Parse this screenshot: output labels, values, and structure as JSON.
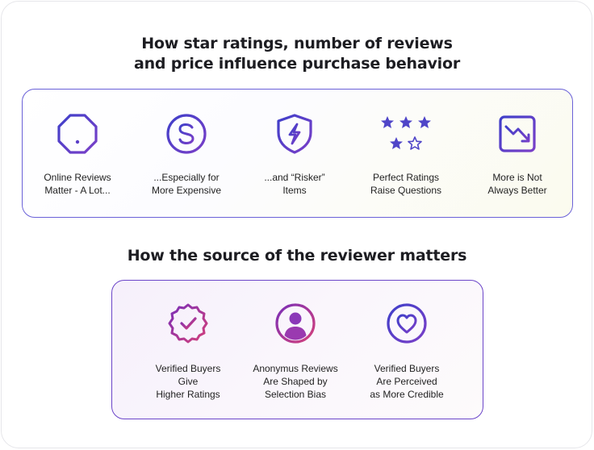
{
  "title1": [
    "How star ratings, number of reviews",
    "and price influence purchase behavior"
  ],
  "title2": "How the source of the reviewer matters",
  "section1": [
    {
      "icon": "warning-octagon-icon",
      "lines": [
        "Online Reviews",
        "Matter - A Lot..."
      ]
    },
    {
      "icon": "dollar-coin-icon",
      "lines": [
        "...Especially for",
        "More Expensive"
      ]
    },
    {
      "icon": "shield-bolt-icon",
      "lines": [
        "...and “Risker”",
        "Items"
      ]
    },
    {
      "icon": "stars-rating-icon",
      "lines": [
        "Perfect Ratings",
        "Raise Questions"
      ]
    },
    {
      "icon": "trending-down-chart-icon",
      "lines": [
        "More is Not",
        "Always Better"
      ]
    }
  ],
  "section2": [
    {
      "icon": "verified-badge-icon",
      "lines": [
        "Verified Buyers",
        "Give",
        "Higher Ratings"
      ]
    },
    {
      "icon": "user-avatar-icon",
      "lines": [
        "Anonymus Reviews",
        "Are Shaped by",
        "Selection Bias"
      ]
    },
    {
      "icon": "heart-circle-icon",
      "lines": [
        "Verified Buyers",
        "Are Perceived",
        "as More Credible"
      ]
    }
  ],
  "colors": {
    "accent_blue": "#5a4fd0",
    "accent_purple": "#8a3fc8",
    "accent_pink": "#c0407e"
  }
}
